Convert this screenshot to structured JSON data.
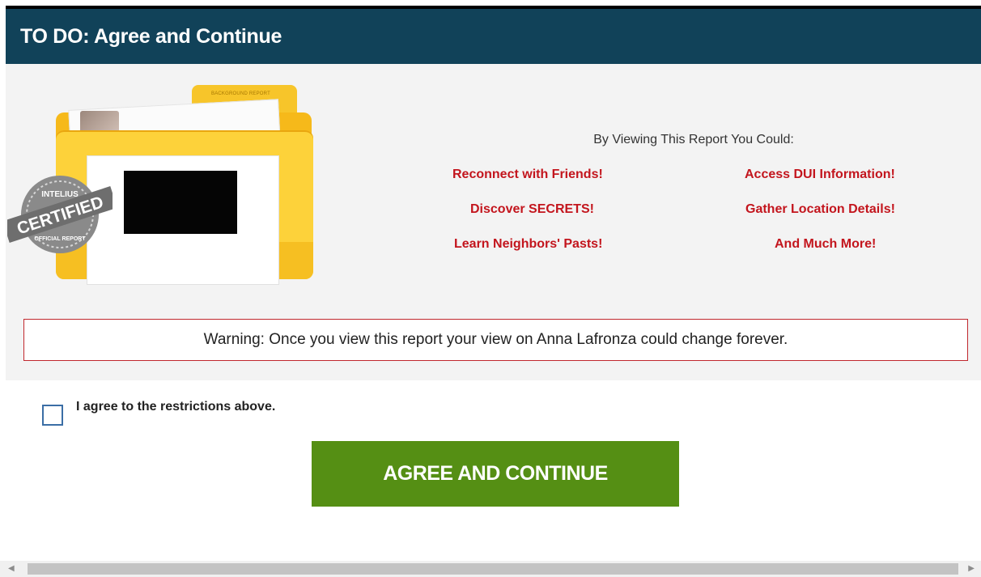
{
  "header": {
    "title": "TO DO: Agree and Continue"
  },
  "illustration": {
    "folder_tab_label": "BACKGROUND REPORT",
    "seal_top_text": "INTELIUS",
    "seal_middle_text": "CERTIFIED",
    "seal_bottom_text": "OFFICIAL REPORT"
  },
  "report": {
    "heading": "By Viewing This Report You Could:",
    "benefits": [
      "Reconnect with Friends!",
      "Access DUI Information!",
      "Discover SECRETS!",
      "Gather Location Details!",
      "Learn Neighbors' Pasts!",
      "And Much More!"
    ]
  },
  "warning": {
    "text": "Warning: Once you view this report your view on Anna Lafronza could change forever."
  },
  "agreement": {
    "checkbox_label": "I agree to the restrictions above.",
    "checked": false
  },
  "actions": {
    "agree_button": "AGREE AND CONTINUE"
  },
  "scrollbar": {
    "left_arrow": "◀",
    "right_arrow": "▶"
  },
  "colors": {
    "header_bg": "#114259",
    "benefit_text": "#c3151d",
    "warning_border": "#c0272d",
    "button_bg": "#558f14",
    "folder_yellow": "#fdd23a"
  }
}
